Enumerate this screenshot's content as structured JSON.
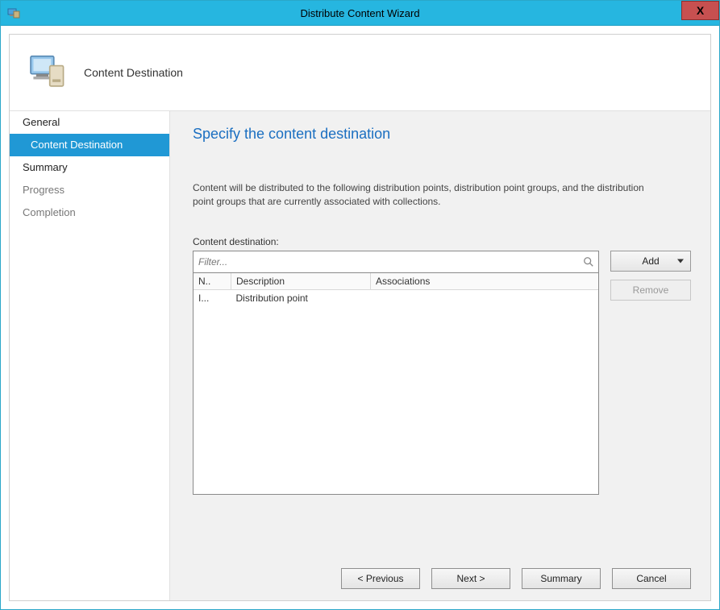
{
  "window": {
    "title": "Distribute Content Wizard",
    "close_label": "X"
  },
  "header": {
    "title": "Content Destination"
  },
  "sidebar": {
    "steps": [
      {
        "label": "General",
        "state": "visited"
      },
      {
        "label": "Content Destination",
        "state": "active"
      },
      {
        "label": "Summary",
        "state": "visited"
      },
      {
        "label": "Progress",
        "state": "pending"
      },
      {
        "label": "Completion",
        "state": "pending"
      }
    ]
  },
  "main": {
    "heading": "Specify the content destination",
    "description": "Content will be distributed to the following distribution points, distribution point groups, and the distribution point groups that are currently associated with collections.",
    "content_destination_label": "Content destination:",
    "filter_placeholder": "Filter...",
    "columns": {
      "name": "N..",
      "description": "Description",
      "associations": "Associations"
    },
    "rows": [
      {
        "name": "I...",
        "description": "Distribution point",
        "associations": ""
      }
    ],
    "buttons": {
      "add": "Add",
      "remove": "Remove"
    }
  },
  "footer": {
    "previous": "< Previous",
    "next": "Next >",
    "summary": "Summary",
    "cancel": "Cancel"
  }
}
